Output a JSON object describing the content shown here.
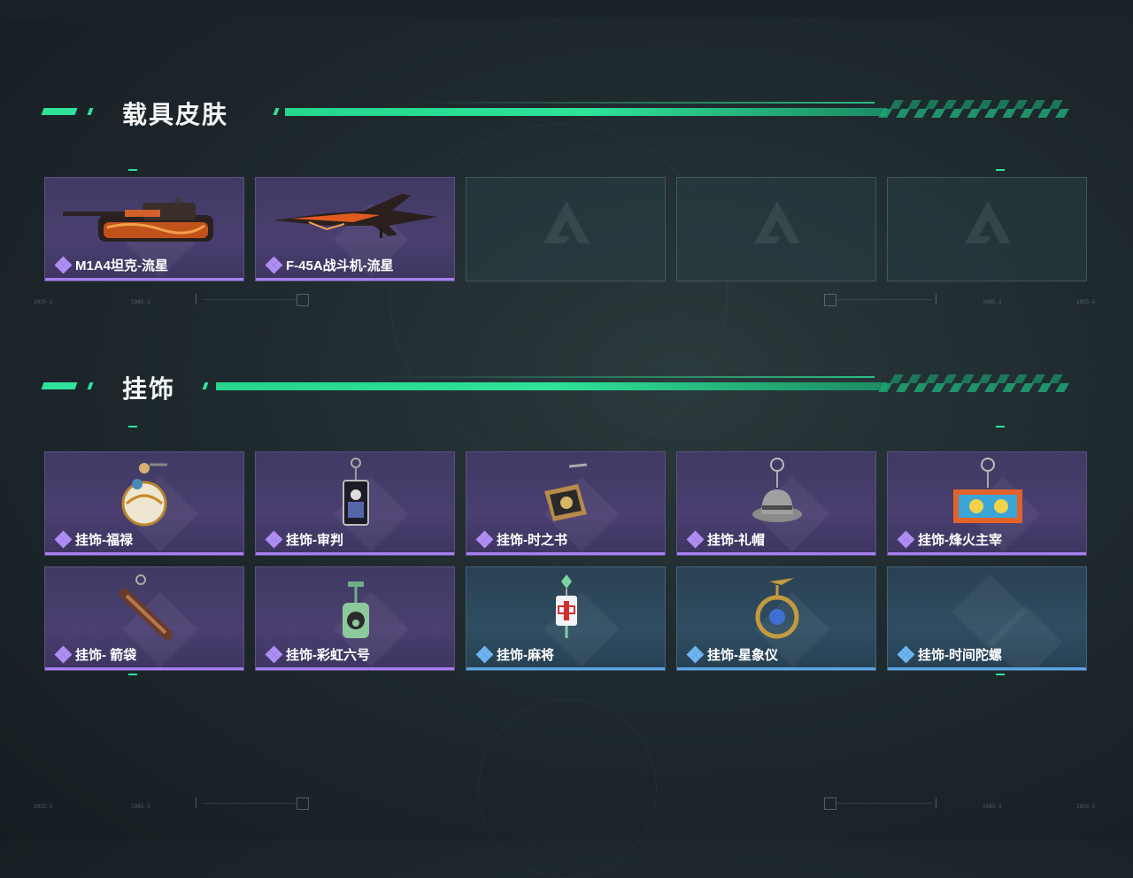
{
  "sections": {
    "vehicle_skins": {
      "title": "载具皮肤",
      "items": [
        {
          "label": "M1A4坦克-流星",
          "rarity": "purple",
          "icon": "tank-icon"
        },
        {
          "label": "F-45A战斗机-流星",
          "rarity": "purple",
          "icon": "fighter-jet-icon"
        },
        {
          "label": "",
          "rarity": "empty",
          "icon": "empty-slot-logo-icon"
        },
        {
          "label": "",
          "rarity": "empty",
          "icon": "empty-slot-logo-icon"
        },
        {
          "label": "",
          "rarity": "empty",
          "icon": "empty-slot-logo-icon"
        }
      ]
    },
    "charms": {
      "title": "挂饰",
      "items": [
        {
          "label": "挂饰-福禄",
          "rarity": "purple",
          "icon": "gourd-charm-icon"
        },
        {
          "label": "挂饰-审判",
          "rarity": "purple",
          "icon": "card-charm-icon"
        },
        {
          "label": "挂饰-时之书",
          "rarity": "purple",
          "icon": "book-charm-icon"
        },
        {
          "label": "挂饰-礼帽",
          "rarity": "purple",
          "icon": "hat-charm-icon"
        },
        {
          "label": "挂饰-烽火主宰",
          "rarity": "purple",
          "icon": "container-charm-icon"
        },
        {
          "label": "挂饰- 箭袋",
          "rarity": "purple",
          "icon": "quiver-charm-icon"
        },
        {
          "label": "挂饰-彩虹六号",
          "rarity": "purple",
          "icon": "six-charm-icon"
        },
        {
          "label": "挂饰-麻将",
          "rarity": "blue",
          "icon": "mahjong-charm-icon"
        },
        {
          "label": "挂饰-星象仪",
          "rarity": "blue",
          "icon": "astrolabe-charm-icon"
        },
        {
          "label": "挂饰-时间陀螺",
          "rarity": "blue",
          "icon": "spinning-top-charm-icon"
        }
      ]
    }
  },
  "colors": {
    "accent": "#2fe39a",
    "rarity_purple": "#a77ff0",
    "rarity_blue": "#5aa5e6"
  }
}
